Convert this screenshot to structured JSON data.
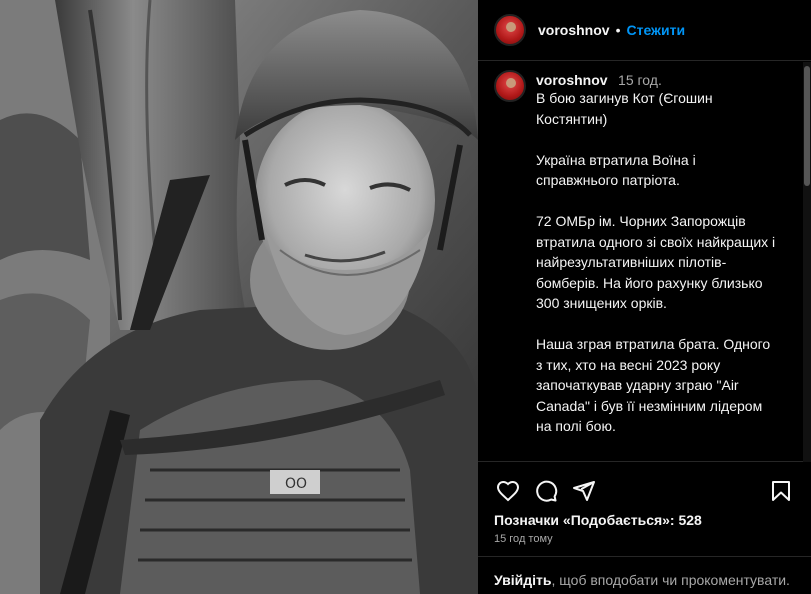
{
  "post": {
    "username": "voroshnov",
    "follow_label": "Стежити",
    "dot": "•"
  },
  "caption": {
    "username": "voroshnov",
    "time": "15 год.",
    "text": "В бою загинув Кот (Єгошин Костянтин)\n\nУкраїна втратила Воїна і справжнього патріота.\n\n72 ОМБр ім. Чорних Запорожців втратила одного зі своїх найкращих і найрезультативніших пілотів-бомберів. На його рахунку близько 300 знищених орків.\n\nНаша зграя втратила брата. Одного з тих, хто на весні 2023 року започаткував ударну зграю \"Air Canada\" і був її незмінним лідером на полі бою.\n\nЯ втратив сина. Учня. Частку себе.\n\nПрощання з Котом відбудеться в"
  },
  "engagement": {
    "likes": "Позначки «Подобається»: 528",
    "posted": "15 год тому"
  },
  "login": {
    "link": "Увійдіть",
    "rest": ", щоб вподобати чи прокоментувати."
  },
  "icons": {
    "like": "heart-icon",
    "comment": "comment-icon",
    "share": "share-icon",
    "save": "bookmark-icon"
  }
}
